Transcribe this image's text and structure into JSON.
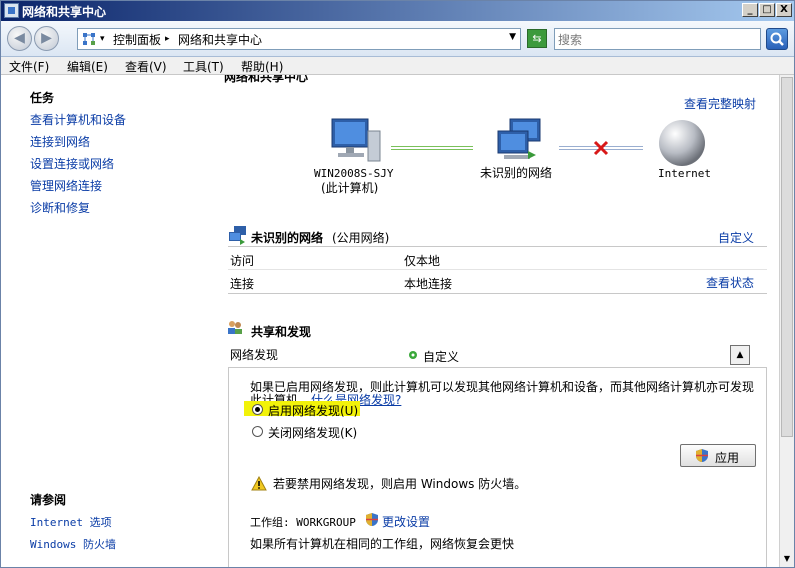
{
  "window": {
    "title": "网络和共享中心"
  },
  "titlebar_buttons": {
    "minimize": "_",
    "maximize": "□",
    "close": "X"
  },
  "address": {
    "crumb1": "控制面板",
    "crumb2": "网络和共享中心",
    "search_placeholder": "搜索"
  },
  "menu": [
    "文件(F)",
    "编辑(E)",
    "查看(V)",
    "工具(T)",
    "帮助(H)"
  ],
  "sidebar": {
    "tasks_header": "任务",
    "tasks": [
      "查看计算机和设备",
      "连接到网络",
      "设置连接或网络",
      "管理网络连接",
      "诊断和修复"
    ],
    "see_also_header": "请参阅",
    "see_also": [
      "Internet 选项",
      "Windows 防火墙"
    ]
  },
  "map": {
    "heading": "网络和共享中心",
    "view_full_map": "查看完整映射",
    "computer_name": "WIN2008S-SJY",
    "computer_sub": "(此计算机)",
    "network_label": "未识别的网络",
    "internet_label": "Internet"
  },
  "network": {
    "name": "未识别的网络",
    "type": "(公用网络)",
    "customize": "自定义",
    "rows": [
      {
        "label": "访问",
        "value": "仅本地",
        "action": ""
      },
      {
        "label": "连接",
        "value": "本地连接",
        "action": "查看状态"
      }
    ]
  },
  "sharing": {
    "header": "共享和发现",
    "discovery_label": "网络发现",
    "discovery_value": "自定义",
    "description_line1": "如果已启用网络发现，则此计算机可以发现其他网络计算机和设备，而其他网络计算机亦可发现",
    "description_line2": "此计算机。",
    "what_is_link": "什么是网络发现?",
    "option_on": "启用网络发现(U)",
    "option_off": "关闭网络发现(K)",
    "apply": "应用",
    "warning": "若要禁用网络发现，则启用 Windows 防火墙。",
    "workgroup_label": "工作组: WORKGROUP",
    "change_settings": "更改设置",
    "footer": "如果所有计算机在相同的工作组，网络恢复会更快"
  }
}
